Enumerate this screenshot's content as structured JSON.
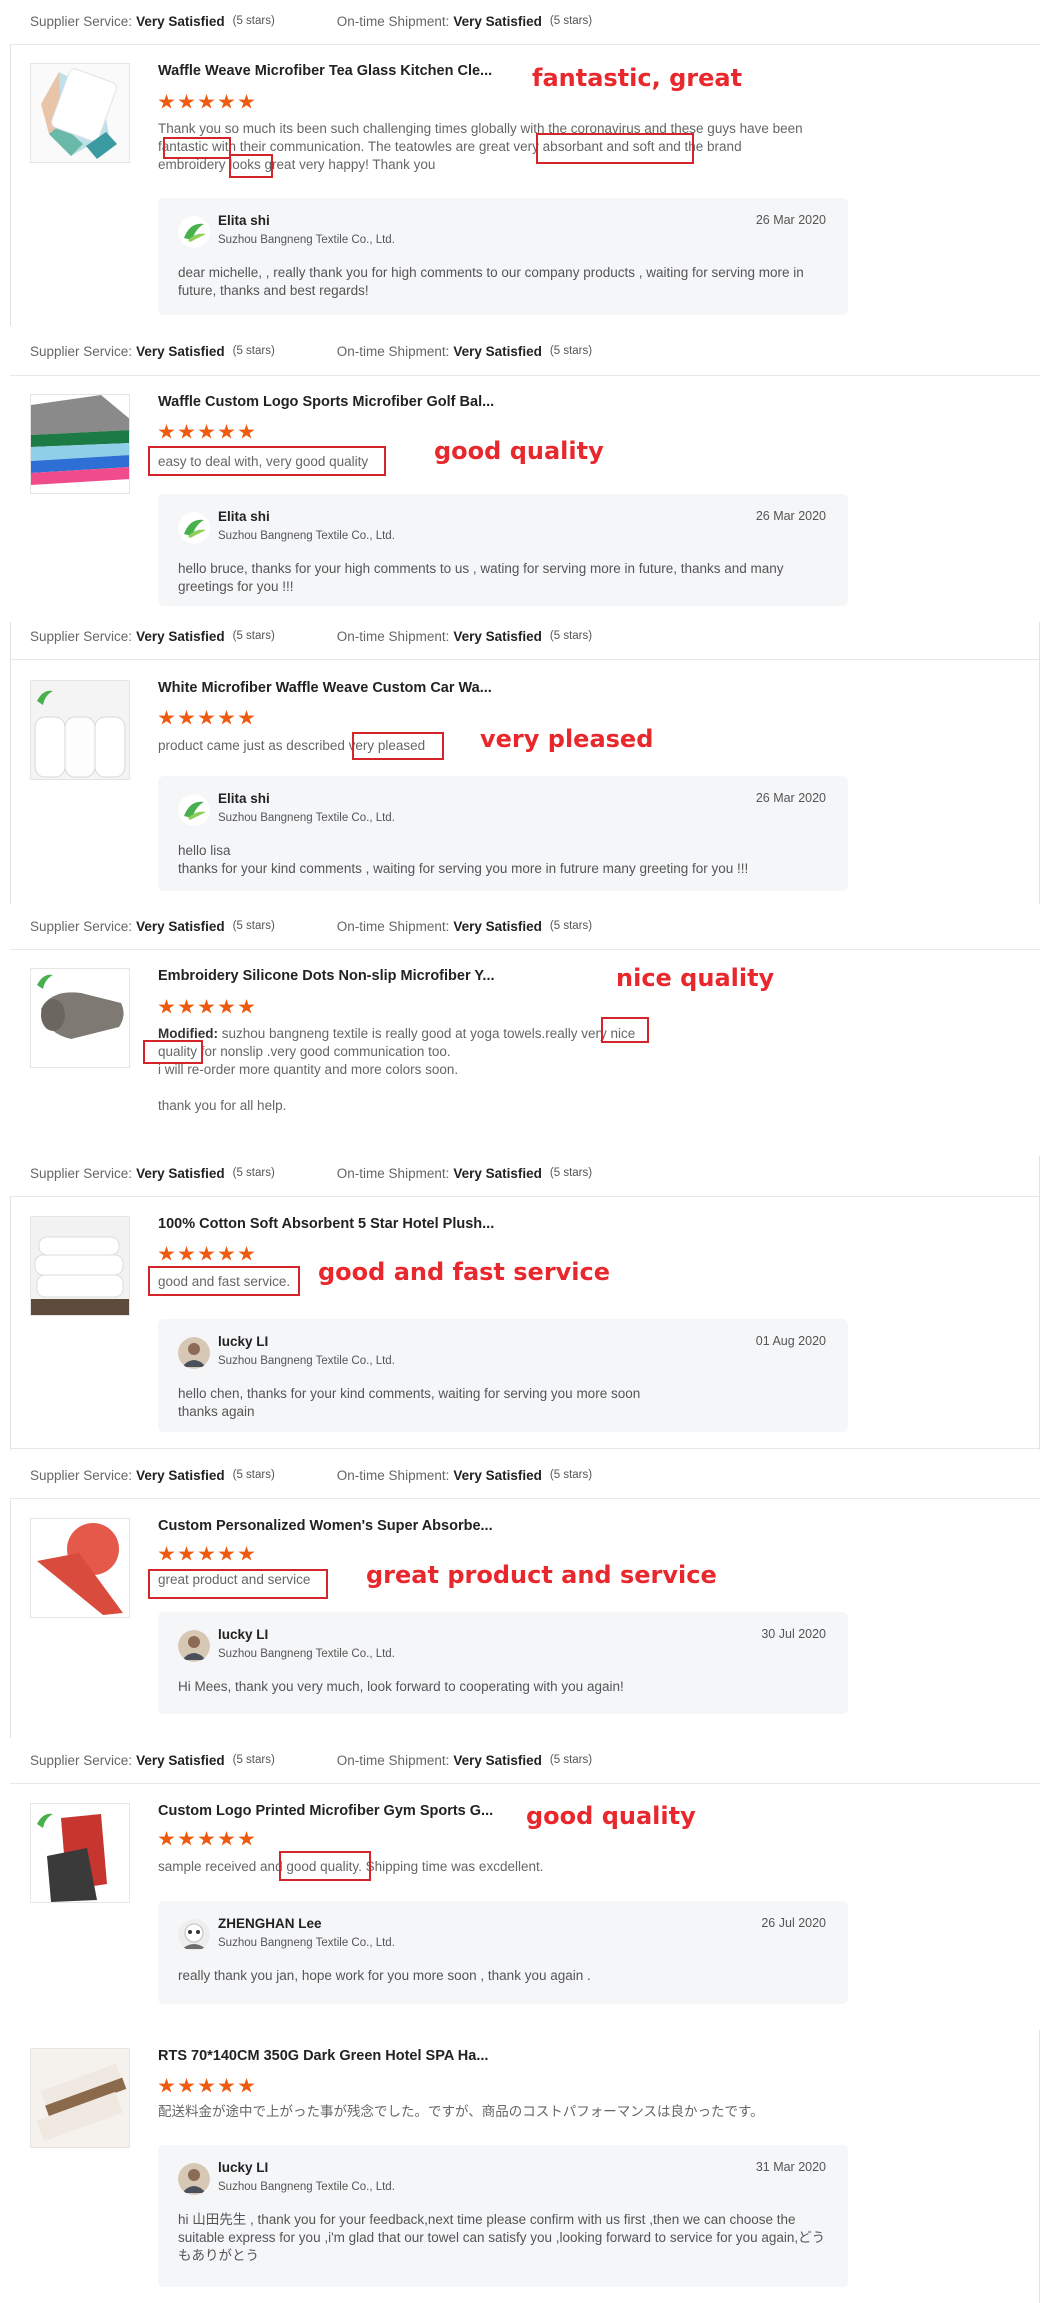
{
  "rating_labels": {
    "supplier": "Supplier Service:",
    "shipment": "On-time Shipment:",
    "value": "Very Satisfied",
    "stars": "(5 stars)"
  },
  "company": "Suzhou Bangneng Textile Co., Ltd.",
  "colors": {
    "star": "#f05a0e",
    "annotation": "#e8282c",
    "reply_bg": "#f5f6f8"
  },
  "reviews": [
    {
      "title": "Waffle Weave Microfiber Tea Glass Kitchen Cle...",
      "text": "Thank you so much its been such challenging times globally with the coronavirus and these guys have been fantastic with their communication. The teatowles are great very absorbant and soft and the brand embroidery looks great very happy! Thank you",
      "reply": {
        "name": "Elita shi",
        "date": "26 Mar 2020",
        "text": "dear michelle, , really thank you for high comments to our company products , waiting for serving more in future, thanks and best regards!"
      },
      "annotation": "fantastic, great"
    },
    {
      "title": "Waffle Custom Logo Sports Microfiber Golf Bal...",
      "text": "easy to deal with, very good quality",
      "reply": {
        "name": "Elita shi",
        "date": "26 Mar 2020",
        "text": "hello bruce, thanks for your high comments to us , wating for serving more in future, thanks and many greetings for you !!!"
      },
      "annotation": "good quality"
    },
    {
      "title": "White Microfiber Waffle Weave Custom Car Wa...",
      "text": "product came just as described very pleased",
      "reply": {
        "name": "Elita shi",
        "date": "26 Mar 2020",
        "text": "hello lisa\nthanks for your kind comments , waiting for serving you more in futrure many greeting for you !!!"
      },
      "annotation": "very pleased"
    },
    {
      "title": "Embroidery Silicone Dots Non-slip Microfiber Y...",
      "modified": "Modified:",
      "text": "suzhou bangneng textile is really good at yoga towels.really very nice quality for nonslip .very good communication  too.\ni will re-order  more quantity and more colors soon.\n\nthank you for all help.",
      "annotation": "nice quality"
    },
    {
      "title": "100% Cotton Soft Absorbent 5 Star Hotel Plush...",
      "text": "good and fast service.",
      "reply": {
        "name": "lucky LI",
        "date": "01 Aug 2020",
        "text": "hello chen, thanks for your kind comments, waiting for serving you more soon\nthanks again"
      },
      "annotation": "good and fast service"
    },
    {
      "title": "Custom Personalized Women's Super Absorbe...",
      "text": "great product and service",
      "reply": {
        "name": "lucky LI",
        "date": "30 Jul 2020",
        "text": "Hi Mees, thank you very much, look forward to cooperating with you again!"
      },
      "annotation": "great product and service"
    },
    {
      "title": "Custom Logo Printed Microfiber Gym Sports G...",
      "text": "sample received and good quality. Shipping time was excdellent.",
      "reply": {
        "name": "ZHENGHAN Lee",
        "date": "26 Jul 2020",
        "text": "really  thank you jan, hope work for you more soon , thank you again ."
      },
      "annotation": "good quality"
    },
    {
      "title": "RTS 70*140CM 350G Dark Green Hotel SPA Ha...",
      "text": "配送料金が途中で上がった事が残念でした。ですが、商品のコストパフォーマンスは良かったです。",
      "reply": {
        "name": "lucky LI",
        "date": "31 Mar 2020",
        "text": "hi 山田先生 , thank you for your feedback,next time please confirm with us first ,then we can choose the suitable express for you ,i'm glad that our towel can satisfy you ,looking forward to service for you again,どうもありがとう"
      }
    }
  ]
}
